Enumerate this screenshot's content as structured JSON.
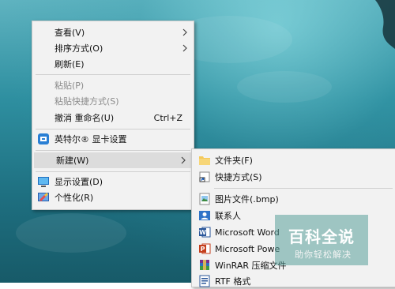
{
  "context_menu": {
    "items": [
      {
        "label": "查看(V)"
      },
      {
        "label": "排序方式(O)"
      },
      {
        "label": "刷新(E)"
      },
      {
        "label": "粘贴(P)"
      },
      {
        "label": "粘贴快捷方式(S)"
      },
      {
        "label": "撤消 重命名(U)",
        "shortcut": "Ctrl+Z"
      },
      {
        "label": "英特尔® 显卡设置",
        "icon": "intel-graphics-icon"
      },
      {
        "label": "新建(W)"
      },
      {
        "label": "显示设置(D)",
        "icon": "display-icon"
      },
      {
        "label": "个性化(R)",
        "icon": "personalize-icon"
      }
    ]
  },
  "new_submenu": {
    "items": [
      {
        "label": "文件夹(F)",
        "icon": "folder-icon"
      },
      {
        "label": "快捷方式(S)",
        "icon": "shortcut-icon"
      },
      {
        "label": "图片文件(.bmp)",
        "icon": "bitmap-icon"
      },
      {
        "label": "联系人",
        "icon": "contact-icon"
      },
      {
        "label": "Microsoft Word",
        "icon": "word-icon"
      },
      {
        "label": "Microsoft Powe",
        "icon": "powerpoint-icon"
      },
      {
        "label": "WinRAR 压缩文件",
        "icon": "winrar-icon"
      },
      {
        "label": "RTF 格式",
        "icon": "rtf-icon"
      }
    ]
  },
  "watermark": {
    "title": "百科全说",
    "subtitle": "助你轻松解决"
  },
  "colors": {
    "menu_bg": "#f2f2f2",
    "hover_bg": "#dcdcdc",
    "disabled_text": "#8a8a8a",
    "desktop_water": "#2e8fa0"
  }
}
